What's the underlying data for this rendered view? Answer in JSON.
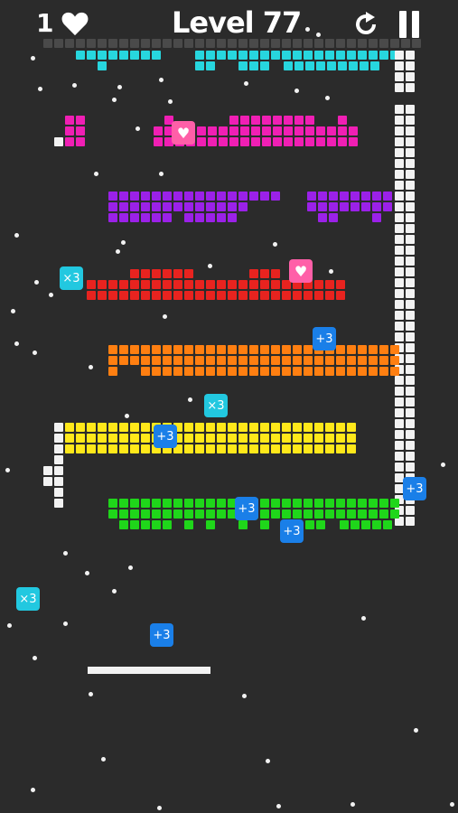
{
  "hud": {
    "lives": "1",
    "level_title": "Level 77",
    "icons": {
      "lives": "heart-icon",
      "restart": "restart-icon",
      "pause": "pause-icon"
    }
  },
  "colors": {
    "background": "#2b2b2b",
    "gray": "#4a4a4a",
    "white": "#f2f2f2",
    "cyan": "#27d6de",
    "magenta": "#f01fb4",
    "purple": "#9b21e8",
    "red": "#e8231f",
    "orange": "#ff7f11",
    "yellow": "#ffe81a",
    "green": "#1fd61a",
    "powerup_plus": "#1a7fe8",
    "powerup_mult": "#22c8e0",
    "powerup_heart": "#ff5fa8"
  },
  "powerups": [
    {
      "label": "×3",
      "kind": "mult"
    },
    {
      "label": "+3",
      "kind": "plus"
    },
    {
      "label": "×3",
      "kind": "mult"
    },
    {
      "label": "+3",
      "kind": "plus"
    },
    {
      "label": "+3",
      "kind": "plus"
    },
    {
      "label": "+3",
      "kind": "plus"
    },
    {
      "label": "+3",
      "kind": "plus"
    },
    {
      "label": "×3",
      "kind": "mult"
    },
    {
      "label": "+3",
      "kind": "plus"
    },
    {
      "label": "",
      "kind": "heart"
    },
    {
      "label": "",
      "kind": "heart"
    }
  ]
}
